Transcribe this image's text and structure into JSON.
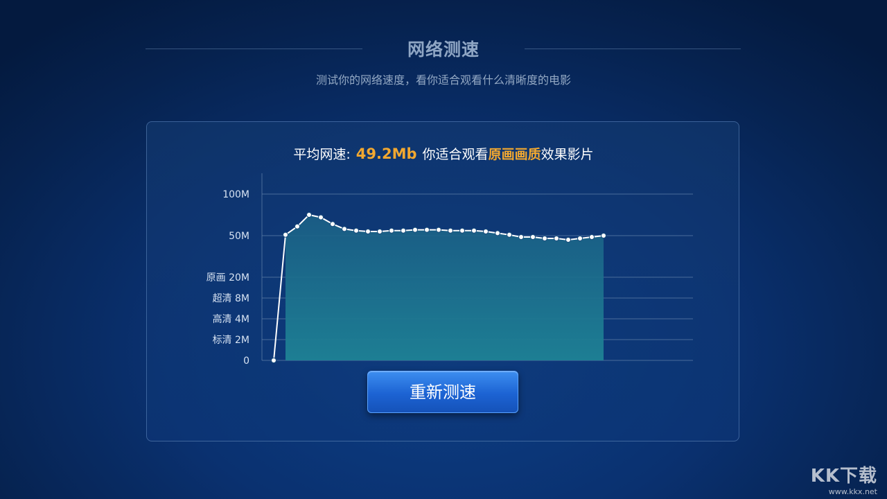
{
  "header": {
    "title": "网络测速",
    "subtitle": "测试你的网络速度，看你适合观看什么清晰度的电影"
  },
  "summary": {
    "label": "平均网速:",
    "speed": "49.2Mb",
    "text_before_quality": "你适合观看",
    "quality": "原画画质",
    "text_after_quality": "效果影片"
  },
  "chart_data": {
    "type": "area",
    "y_tick_labels": [
      "100M",
      "50M",
      "原画 20M",
      "超清 8M",
      "高清 4M",
      "标清 2M",
      "0"
    ],
    "y_ticks_mbps": [
      100,
      50,
      20,
      8,
      4,
      2,
      0
    ],
    "x": [
      0,
      1,
      2,
      3,
      4,
      5,
      6,
      7,
      8,
      9,
      10,
      11,
      12,
      13,
      14,
      15,
      16,
      17,
      18,
      19,
      20,
      21,
      22,
      23,
      24,
      25,
      26,
      27,
      28
    ],
    "values": [
      0,
      51,
      61,
      75,
      72,
      64,
      58,
      56,
      55,
      55,
      56,
      56,
      57,
      57,
      57,
      56,
      56,
      56,
      55,
      53,
      51,
      49,
      49,
      48,
      48,
      47,
      48,
      49,
      50
    ],
    "grid": true,
    "colors": {
      "line": "#ffffff",
      "fill_top": "#1f6f88",
      "fill_bottom": "#1d7f95",
      "grid": "#5f7fa8"
    }
  },
  "actions": {
    "retest_label": "重新测速"
  },
  "watermark": {
    "logo": "KK下载",
    "url": "www.kkx.net"
  }
}
